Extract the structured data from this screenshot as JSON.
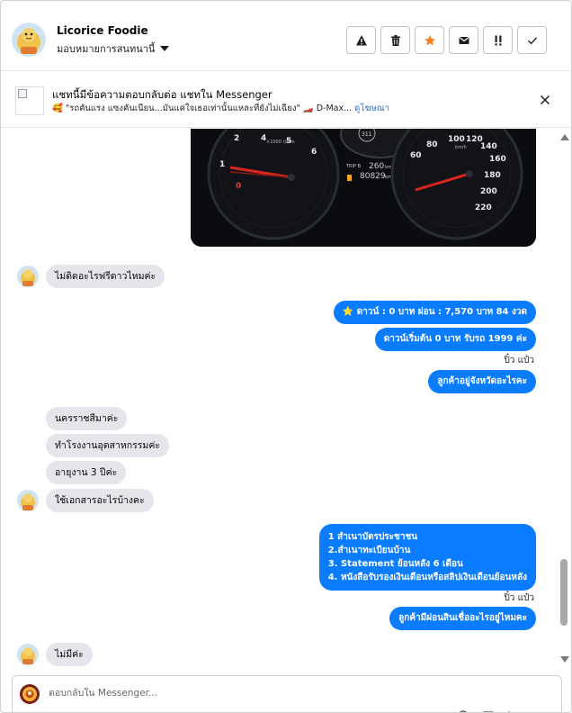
{
  "header": {
    "name": "Licorice Foodie",
    "assign_label": "มอบหมายการสนทนานี้",
    "actions": [
      {
        "icon": "warning-icon",
        "color": "#1c1e21"
      },
      {
        "icon": "trash-icon",
        "color": "#1c1e21"
      },
      {
        "icon": "star-icon",
        "color": "#f5821f"
      },
      {
        "icon": "mail-icon",
        "color": "#1c1e21"
      },
      {
        "icon": "priority-icon",
        "color": "#1c1e21"
      },
      {
        "icon": "check-icon",
        "color": "#1c1e21"
      }
    ]
  },
  "banner": {
    "title": "แชทนี้มีข้อความตอบกลับต่อ แชทใน Messenger",
    "subtitle_emoji": "🥰",
    "subtitle_text": "\"รถคันแรง แซงคันเนียน...มันแค่ใจเธอเท่านั้นแหละที่ยังไม่เฉียง\" 🏎️ D-Max...",
    "link": "ดูโฆษณา"
  },
  "messages": {
    "in_1": "ไม่ดิดอะไรฟรีดาวไหมค่ะ",
    "out_1": "⭐ ดาวน์ : 0 บาท ผ่อน : 7,570 บาท 84 งวด",
    "out_2": "ดาวน์เริ่มต้น 0 บาท รับรถ 1999 ค่ะ",
    "sender_1": "ปิ๋ว แป๋ว",
    "out_3": "ลูกค้าอยู่จังหวัดอะไรคะ",
    "in_2": "นครราชสีมาค่ะ",
    "in_3": "ทำโรงงานอุตสาหกรรมค่ะ",
    "in_4": "อายุงาน  3  ปีค่ะ",
    "in_5": "ใช้เอกสารอะไรบ้างคะ",
    "out_4_lines": [
      "1 สำเนาบัตรประชาชน",
      "2.สำเนาทะเบียนบ้าน",
      "  3. Statement ย้อนหลัง 6 เดือน",
      "4. หนังสือรับรองเงินเดือนหรือสลิปเงินเดือนย้อนหลัง"
    ],
    "sender_2": "ปิ๋ว แป๋ว",
    "out_5": "ลูกค้ามีผ่อนสินเชื่ออะไรอยู่ไหมคะ",
    "in_6": "ไม่มีค่ะ"
  },
  "composer": {
    "placeholder": "ตอบกลับใน Messenger..."
  },
  "colors": {
    "outgoing_bubble": "#0a7cff",
    "incoming_bubble": "#e4e6eb",
    "link": "#216fdb",
    "star": "#f5821f"
  }
}
